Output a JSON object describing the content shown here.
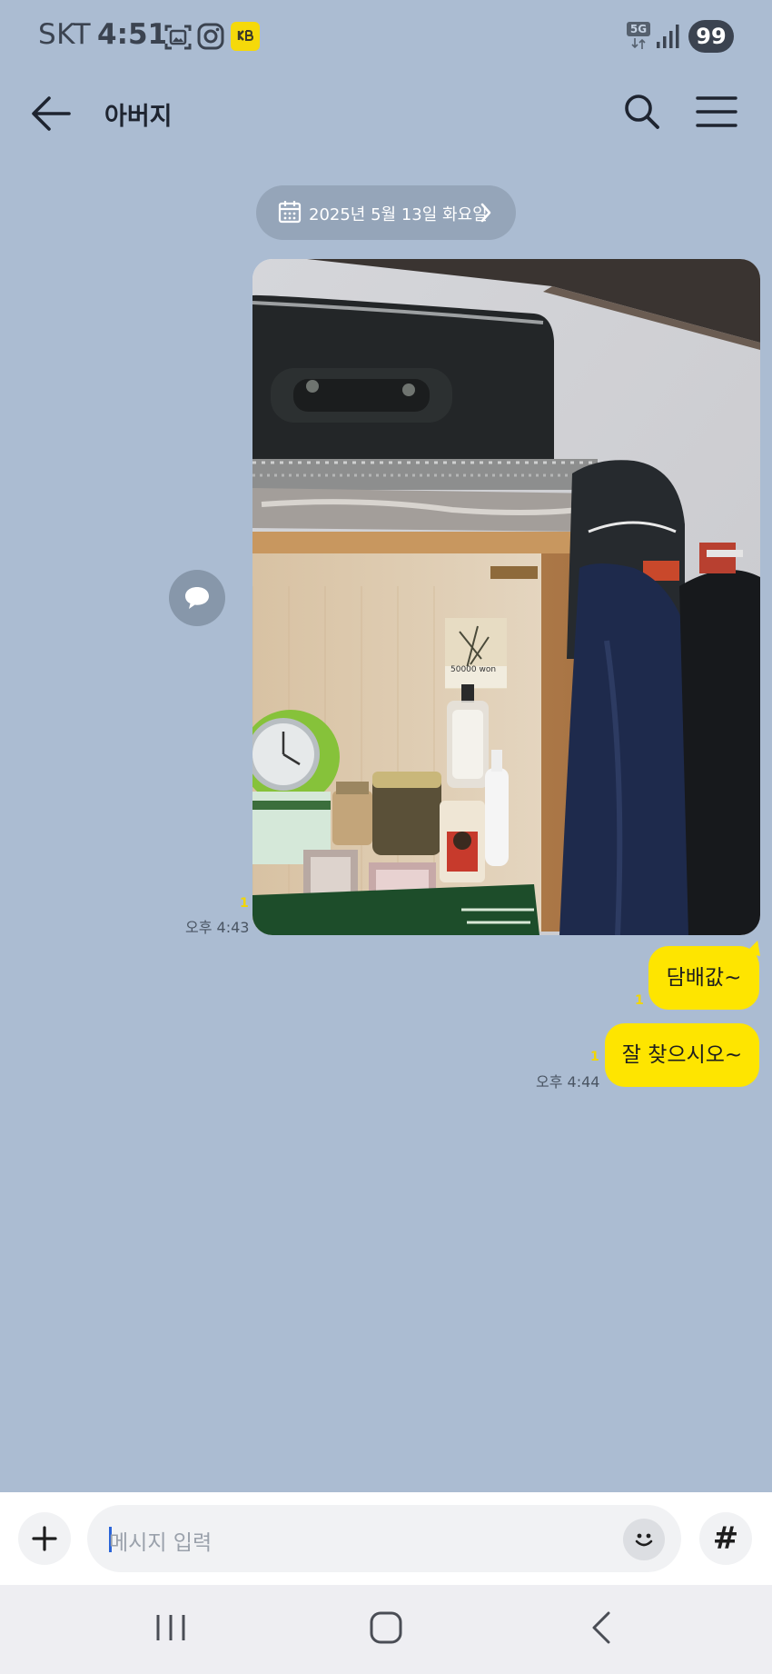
{
  "status_bar": {
    "carrier": "SKT",
    "time": "4:51",
    "network": "5G",
    "battery": "99",
    "icons": [
      "gallery-icon",
      "instagram-icon",
      "kb-app-icon",
      "signal-icon"
    ]
  },
  "header": {
    "title": "아버지",
    "back_icon": "arrow-left-icon",
    "search_icon": "search-icon",
    "menu_icon": "menu-icon"
  },
  "date_divider": {
    "label": "2025년 5월 13일 화요일"
  },
  "messages": [
    {
      "type": "photo",
      "unread": "1",
      "time": "오후 4:43",
      "photo_label": "50000 won"
    },
    {
      "type": "text",
      "text": "담배값~",
      "unread": "1"
    },
    {
      "type": "text",
      "text": "잘 찾으시오~",
      "unread": "1",
      "time": "오후 4:44"
    }
  ],
  "input": {
    "placeholder": "메시지 입력"
  },
  "colors": {
    "background": "#abbcd2",
    "my_bubble": "#fee500",
    "unread_count": "#f2d600",
    "date_pill": "#95a5b9"
  }
}
